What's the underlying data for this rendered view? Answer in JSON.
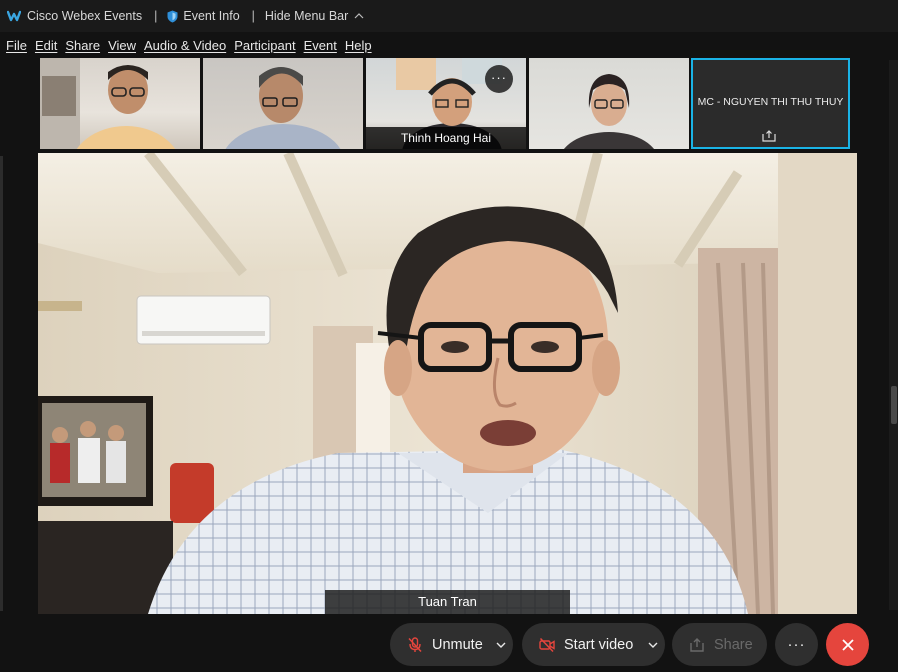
{
  "titlebar": {
    "app_name": "Cisco Webex Events",
    "event_info": "Event Info",
    "hide_menu_bar": "Hide Menu Bar"
  },
  "menu": [
    "File",
    "Edit",
    "Share",
    "View",
    "Audio & Video",
    "Participant",
    "Event",
    "Help"
  ],
  "thumbnails": {
    "third_name": "Thinh Hoang Hai",
    "third_more": "···",
    "fifth_name": "MC - NGUYEN THI THU THUY"
  },
  "main": {
    "speaker_name": "Tuan Tran"
  },
  "controls": {
    "unmute": "Unmute",
    "start_video": "Start video",
    "share": "Share",
    "more": "···"
  },
  "colors": {
    "active_border": "#1ab3e6",
    "leave": "#e5453d",
    "mute_icon": "#e5453d"
  }
}
